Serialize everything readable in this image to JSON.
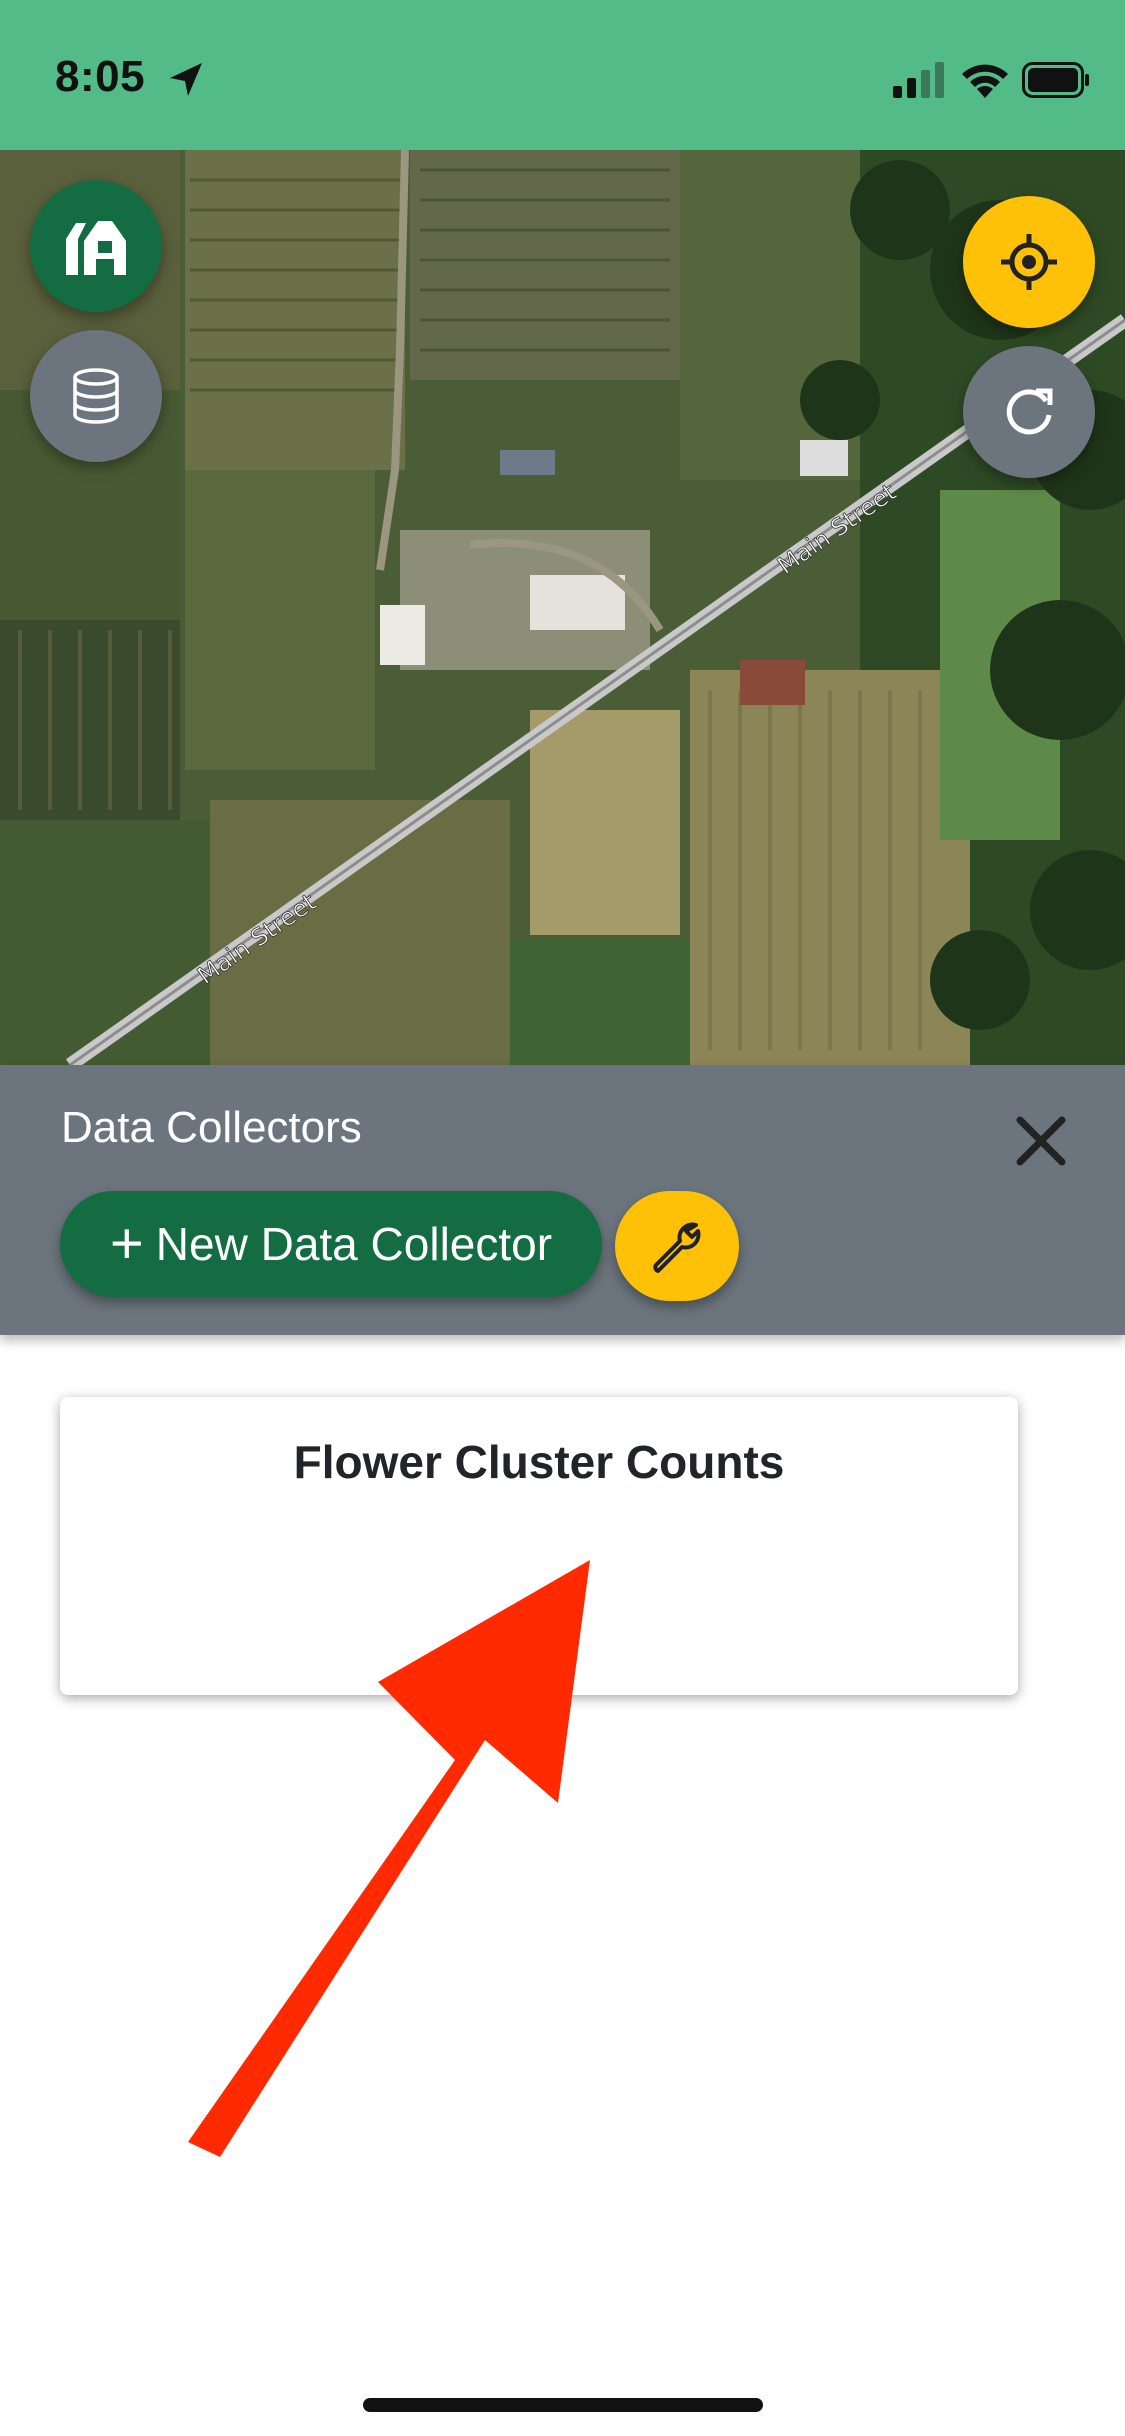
{
  "status_bar": {
    "time": "8:05",
    "icons": [
      "location-arrow-icon",
      "cellular-signal-icon",
      "wifi-icon",
      "battery-icon"
    ]
  },
  "map": {
    "street_labels": [
      "Main Street",
      "Main Street"
    ],
    "buttons": {
      "farm": "farm-icon",
      "layers": "database-icon",
      "locate": "crosshair-icon",
      "refresh": "refresh-icon"
    }
  },
  "panel": {
    "title": "Data Collectors",
    "new_button_label": "New Data Collector",
    "plus_symbol": "+",
    "close_icon": "close-icon",
    "settings_icon": "wrench-icon"
  },
  "collectors": [
    {
      "title": "Flower Cluster Counts"
    }
  ],
  "colors": {
    "status_bar": "#52bb87",
    "primary_green": "#146c43",
    "panel_gray": "#6c757d",
    "accent_yellow": "#ffc107",
    "annotation_red": "#ff2a00"
  }
}
